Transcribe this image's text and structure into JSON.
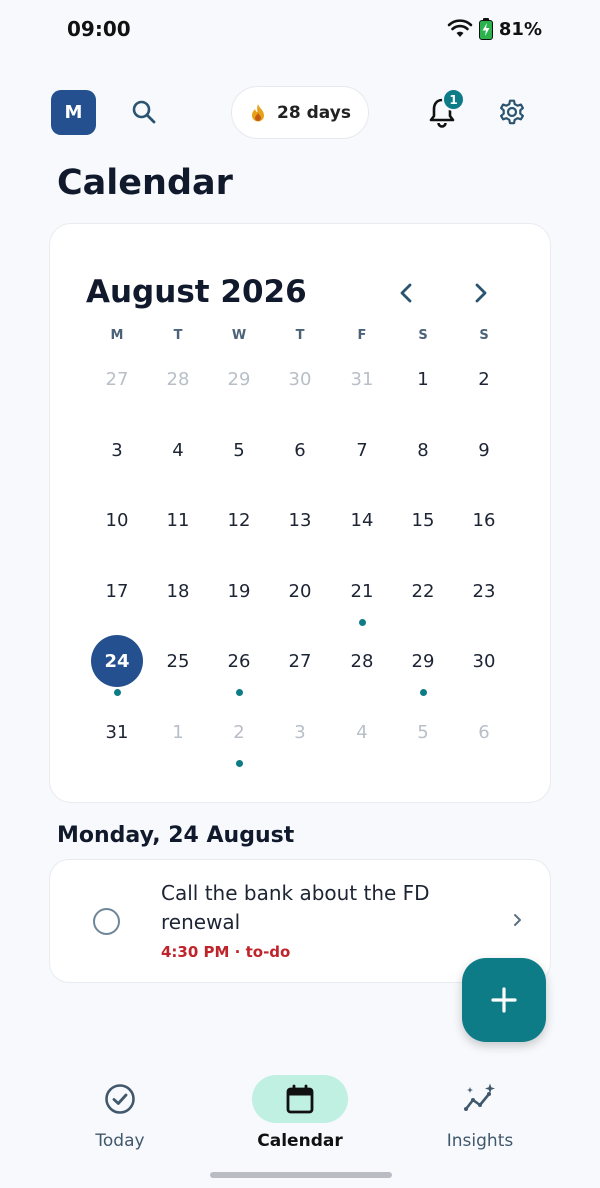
{
  "status_bar": {
    "time": "09:00",
    "battery": "81%",
    "icons": [
      "wifi-icon",
      "battery-charging-icon"
    ]
  },
  "header": {
    "avatar_initial": "M",
    "streak": "28 days",
    "notification_count": "1",
    "title": "Calendar"
  },
  "calendar": {
    "month_label": "August 2026",
    "weekdays": [
      "M",
      "T",
      "W",
      "T",
      "F",
      "S",
      "S"
    ],
    "weeks": [
      [
        {
          "d": "27",
          "m": true
        },
        {
          "d": "28",
          "m": true
        },
        {
          "d": "29",
          "m": true
        },
        {
          "d": "30",
          "m": true
        },
        {
          "d": "31",
          "m": true
        },
        {
          "d": "1"
        },
        {
          "d": "2"
        }
      ],
      [
        {
          "d": "3"
        },
        {
          "d": "4"
        },
        {
          "d": "5"
        },
        {
          "d": "6"
        },
        {
          "d": "7"
        },
        {
          "d": "8"
        },
        {
          "d": "9"
        }
      ],
      [
        {
          "d": "10"
        },
        {
          "d": "11"
        },
        {
          "d": "12"
        },
        {
          "d": "13"
        },
        {
          "d": "14"
        },
        {
          "d": "15"
        },
        {
          "d": "16"
        }
      ],
      [
        {
          "d": "17"
        },
        {
          "d": "18"
        },
        {
          "d": "19"
        },
        {
          "d": "20"
        },
        {
          "d": "21",
          "dot": true
        },
        {
          "d": "22"
        },
        {
          "d": "23"
        }
      ],
      [
        {
          "d": "24",
          "selected": true,
          "dot": true
        },
        {
          "d": "25"
        },
        {
          "d": "26",
          "dot": true
        },
        {
          "d": "27"
        },
        {
          "d": "28"
        },
        {
          "d": "29",
          "dot": true
        },
        {
          "d": "30"
        }
      ],
      [
        {
          "d": "31"
        },
        {
          "d": "1",
          "m": true
        },
        {
          "d": "2",
          "m": true,
          "dot": true
        },
        {
          "d": "3",
          "m": true
        },
        {
          "d": "4",
          "m": true
        },
        {
          "d": "5",
          "m": true
        },
        {
          "d": "6",
          "m": true
        }
      ]
    ]
  },
  "selected_day": {
    "heading": "Monday, 24 August",
    "task": {
      "title": "Call the bank about the FD renewal",
      "meta": "4:30 PM · to-do"
    }
  },
  "bottom_nav": {
    "items": [
      {
        "label": "Today",
        "icon": "check-circle-icon",
        "active": false
      },
      {
        "label": "Calendar",
        "icon": "calendar-icon",
        "active": true
      },
      {
        "label": "Insights",
        "icon": "insights-sparkle-icon",
        "active": false
      }
    ]
  },
  "colors": {
    "primary": "#24508f",
    "accent": "#0e7c86",
    "active_nav": "#bff0e1",
    "meta_red": "#c0242b"
  }
}
